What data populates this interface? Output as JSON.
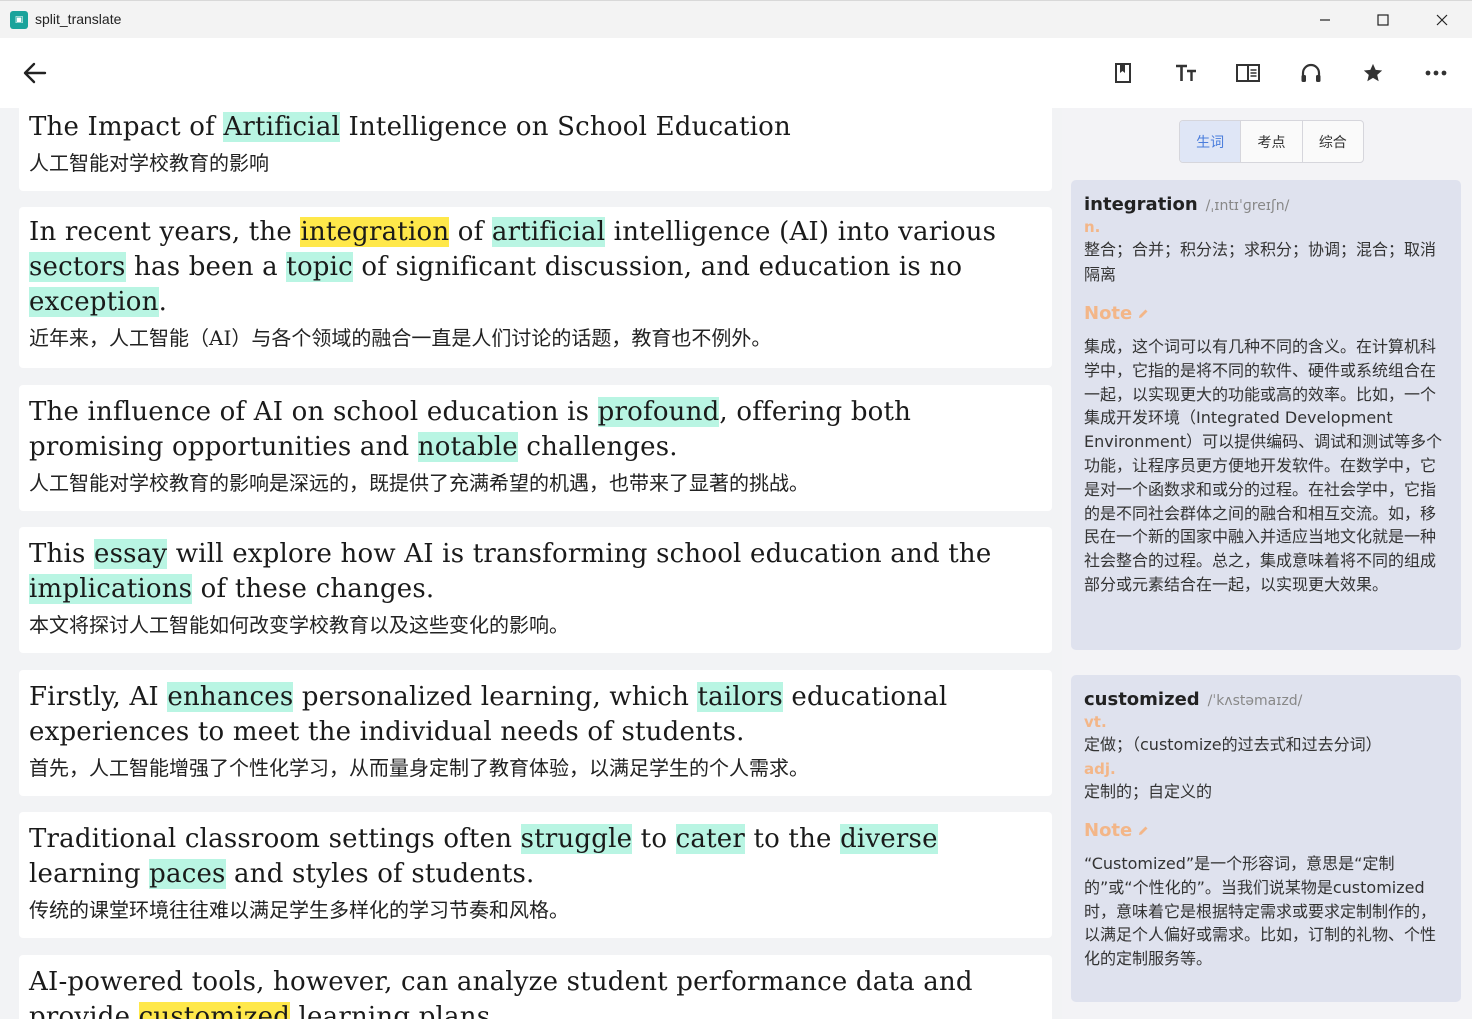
{
  "window": {
    "title": "split_translate",
    "app_icon_glyph": "▣"
  },
  "toolbar": {
    "icons": [
      "bookmark-icon",
      "font-size-icon",
      "split-view-icon",
      "headphones-icon",
      "star-icon",
      "more-icon"
    ]
  },
  "colors": {
    "highlight_green": "#b9f5e3",
    "highlight_yellow": "#ffe84a",
    "accent_blue": "#4a7ddc",
    "pos_orange": "#f3b688"
  },
  "cards": [
    {
      "en": [
        {
          "t": "The Impact of "
        },
        {
          "t": "Artificial",
          "h": "g"
        },
        {
          "t": " Intelligence on School Education"
        }
      ],
      "zh": "人工智能对学校教育的影响"
    },
    {
      "en": [
        {
          "t": "In recent years, the "
        },
        {
          "t": "integration",
          "h": "y"
        },
        {
          "t": " of "
        },
        {
          "t": "artificial",
          "h": "g"
        },
        {
          "t": " intelligence (AI) into various "
        },
        {
          "t": "sectors",
          "h": "g"
        },
        {
          "t": " has been a "
        },
        {
          "t": "topic",
          "h": "g"
        },
        {
          "t": " of significant discussion, and education is no "
        },
        {
          "t": "exception",
          "h": "g"
        },
        {
          "t": "."
        }
      ],
      "zh": "近年来，人工智能（AI）与各个领域的融合一直是人们讨论的话题，教育也不例外。"
    },
    {
      "en": [
        {
          "t": "The influence of AI on school education is "
        },
        {
          "t": "profound",
          "h": "g"
        },
        {
          "t": ", offering both promising opportunities and "
        },
        {
          "t": "notable",
          "h": "g"
        },
        {
          "t": " challenges."
        }
      ],
      "zh": "人工智能对学校教育的影响是深远的，既提供了充满希望的机遇，也带来了显著的挑战。"
    },
    {
      "en": [
        {
          "t": "This "
        },
        {
          "t": "essay",
          "h": "g"
        },
        {
          "t": " will explore how AI is transforming school education and the "
        },
        {
          "t": "implications",
          "h": "g"
        },
        {
          "t": " of these changes."
        }
      ],
      "zh": "本文将探讨人工智能如何改变学校教育以及这些变化的影响。"
    },
    {
      "en": [
        {
          "t": "Firstly, AI "
        },
        {
          "t": "enhances",
          "h": "g"
        },
        {
          "t": " personalized learning, which "
        },
        {
          "t": "tailors",
          "h": "g"
        },
        {
          "t": " educational experiences to meet the individual needs of students."
        }
      ],
      "zh": "首先，人工智能增强了个性化学习，从而量身定制了教育体验，以满足学生的个人需求。"
    },
    {
      "en": [
        {
          "t": "Traditional classroom settings often "
        },
        {
          "t": "struggle",
          "h": "g"
        },
        {
          "t": " to "
        },
        {
          "t": "cater",
          "h": "g"
        },
        {
          "t": " to the "
        },
        {
          "t": "diverse",
          "h": "g"
        },
        {
          "t": " learning "
        },
        {
          "t": "paces",
          "h": "g"
        },
        {
          "t": " and styles of students."
        }
      ],
      "zh": "传统的课堂环境往往难以满足学生多样化的学习节奏和风格。"
    },
    {
      "en": [
        {
          "t": "AI-powered tools, however, can analyze student performance data and provide "
        },
        {
          "t": "customized",
          "h": "y"
        },
        {
          "t": " learning plans."
        }
      ],
      "zh": ""
    }
  ],
  "sidebar": {
    "tabs": [
      "生词",
      "考点",
      "综合"
    ],
    "active_tab": 0,
    "note_label": "Note",
    "words": [
      {
        "word": "integration",
        "phonetic": "/ˌɪntɪˈɡreɪʃn/",
        "senses": [
          {
            "pos": "n.",
            "def": "整合；合并；积分法；求积分；协调；混合；取消隔离"
          }
        ],
        "note": "集成，这个词可以有几种不同的含义。在计算机科学中，它指的是将不同的软件、硬件或系统组合在一起，以实现更大的功能或高的效率。比如，一个集成开发环境（Integrated Development Environment）可以提供编码、调试和测试等多个功能，让程序员更方便地开发软件。在数学中，它是对一个函数求和或分的过程。在社会学中，它指的是不同社会群体之间的融合和相互交流。如，移民在一个新的国家中融入并适应当地文化就是一种社会整合的过程。总之，集成意味着将不同的组成部分或元素结合在一起，以实现更大效果。"
      },
      {
        "word": "customized",
        "phonetic": "/ˈkʌstəmaɪzd/",
        "senses": [
          {
            "pos": "vt.",
            "def": "定做；（customize的过去式和过去分词）"
          },
          {
            "pos": "adj.",
            "def": "定制的；自定义的"
          }
        ],
        "note": "“Customized”是一个形容词，意思是“定制的”或“个性化的”。当我们说某物是customized时，意味着它是根据特定需求或要求定制制作的，以满足个人偏好或需求。比如，订制的礼物、个性化的定制服务等。"
      }
    ]
  }
}
